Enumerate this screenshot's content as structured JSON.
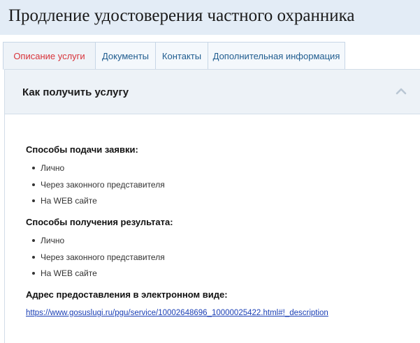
{
  "page": {
    "title": "Продление удостоверения частного охранника"
  },
  "tabs": [
    {
      "label": "Описание услуги",
      "active": true
    },
    {
      "label": "Документы",
      "active": false
    },
    {
      "label": "Контакты",
      "active": false
    },
    {
      "label": "Дополнительная информация",
      "active": false
    }
  ],
  "accordion": {
    "title": "Как получить услугу",
    "icon": "chevron-up-icon"
  },
  "sections": {
    "submit": {
      "heading": "Способы подачи заявки:",
      "items": [
        "Лично",
        "Через законного представителя",
        "На WEB сайте"
      ]
    },
    "receive": {
      "heading": "Способы получения результата:",
      "items": [
        "Лично",
        "Через законного представителя",
        "На WEB сайте"
      ]
    },
    "electronic": {
      "heading": "Адрес предоставления в электронном виде:",
      "link": "https://www.gosuslugi.ru/pgu/service/10002648696_10000025422.html#!_description"
    }
  },
  "colors": {
    "active_tab": "#d8333a",
    "tab_text": "#1f5c8f",
    "link": "#1a3fb5",
    "header_bg": "#e3ecf6"
  }
}
